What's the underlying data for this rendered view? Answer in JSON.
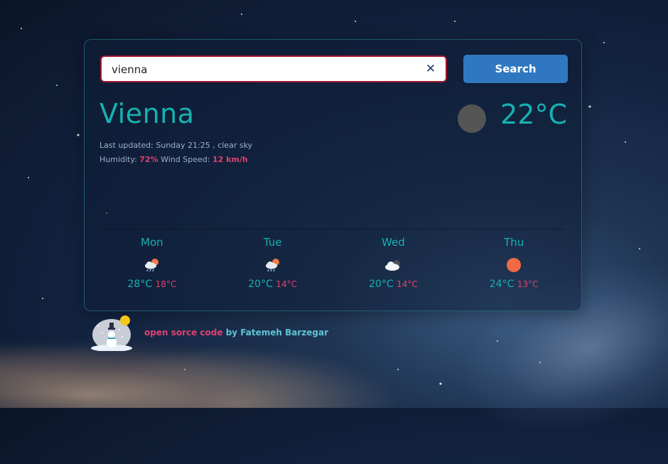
{
  "search": {
    "value": "vienna",
    "clear_label": "✕",
    "button_label": "Search"
  },
  "current": {
    "city": "Vienna",
    "temp": "22°C",
    "last_updated_label": "Last updated:",
    "last_updated": "Sunday 21:25 , clear sky",
    "humidity_label": "Humidity:",
    "humidity": "72%",
    "wind_label": "Wind Speed:",
    "wind": "12 km/h",
    "icon": "moon-icon"
  },
  "forecast": [
    {
      "day": "Mon",
      "icon": "rain-sun-icon",
      "max": "28°C",
      "min": "18°C"
    },
    {
      "day": "Tue",
      "icon": "rain-sun-icon",
      "max": "20°C",
      "min": "14°C"
    },
    {
      "day": "Wed",
      "icon": "cloud-sun-icon",
      "max": "20°C",
      "min": "14°C"
    },
    {
      "day": "Thu",
      "icon": "sun-icon",
      "max": "24°C",
      "min": "13°C"
    }
  ],
  "footer": {
    "link_text": "open sorce code",
    "by_text": "by Fatemeh Barzegar"
  },
  "colors": {
    "accent": "#17b1b1",
    "highlight": "#e0406f",
    "button": "#2f78c1"
  }
}
